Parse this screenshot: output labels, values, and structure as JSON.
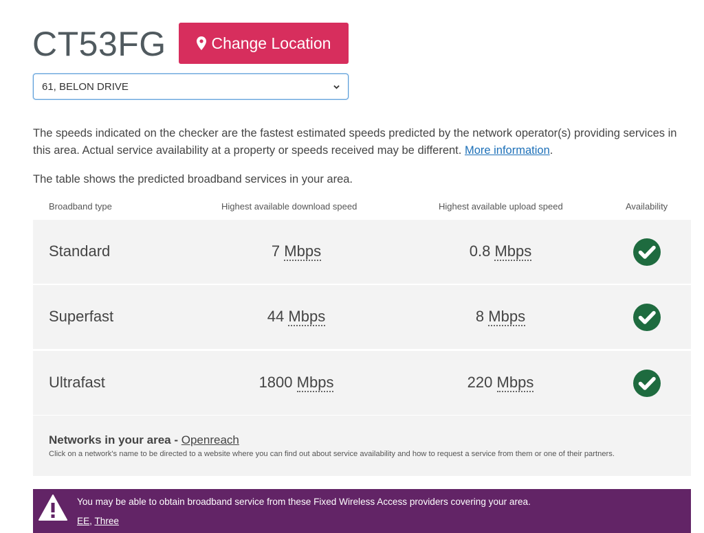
{
  "header": {
    "postcode": "CT53FG",
    "change_location_label": "Change Location"
  },
  "address": {
    "selected": "61, BELON DRIVE"
  },
  "info": {
    "text": "The speeds indicated on the checker are the fastest estimated speeds predicted by the network operator(s) providing services in this area. Actual service availability at a property or speeds received may be different.",
    "link": "More information",
    "after_link": "."
  },
  "table_intro": "The table shows the predicted broadband services in your area.",
  "table": {
    "headers": {
      "type": "Broadband type",
      "download": "Highest available download speed",
      "upload": "Highest available upload speed",
      "availability": "Availability"
    },
    "rows": [
      {
        "type": "Standard",
        "download": "7",
        "upload": "0.8",
        "unit": "Mbps",
        "available": true
      },
      {
        "type": "Superfast",
        "download": "44",
        "upload": "8",
        "unit": "Mbps",
        "available": true
      },
      {
        "type": "Ultrafast",
        "download": "1800",
        "upload": "220",
        "unit": "Mbps",
        "available": true
      }
    ]
  },
  "networks": {
    "title": "Networks in your area -",
    "provider": "Openreach",
    "note": "Click on a network's name to be directed to a website where you can find out about service availability and how to request a service from them or one of their partners."
  },
  "fwa": {
    "message": "You may be able to obtain broadband service from these Fixed Wireless Access providers covering your area.",
    "providers": [
      "EE",
      "Three"
    ],
    "separator": ", "
  },
  "colors": {
    "button": "#d72e5d",
    "check": "#1e6b3f",
    "banner": "#622466",
    "link": "#1d70b8"
  },
  "icons": {
    "button": "map-pin-icon",
    "select": "chevron-down-icon",
    "availability": "check-circle-icon",
    "banner": "warning-icon"
  }
}
